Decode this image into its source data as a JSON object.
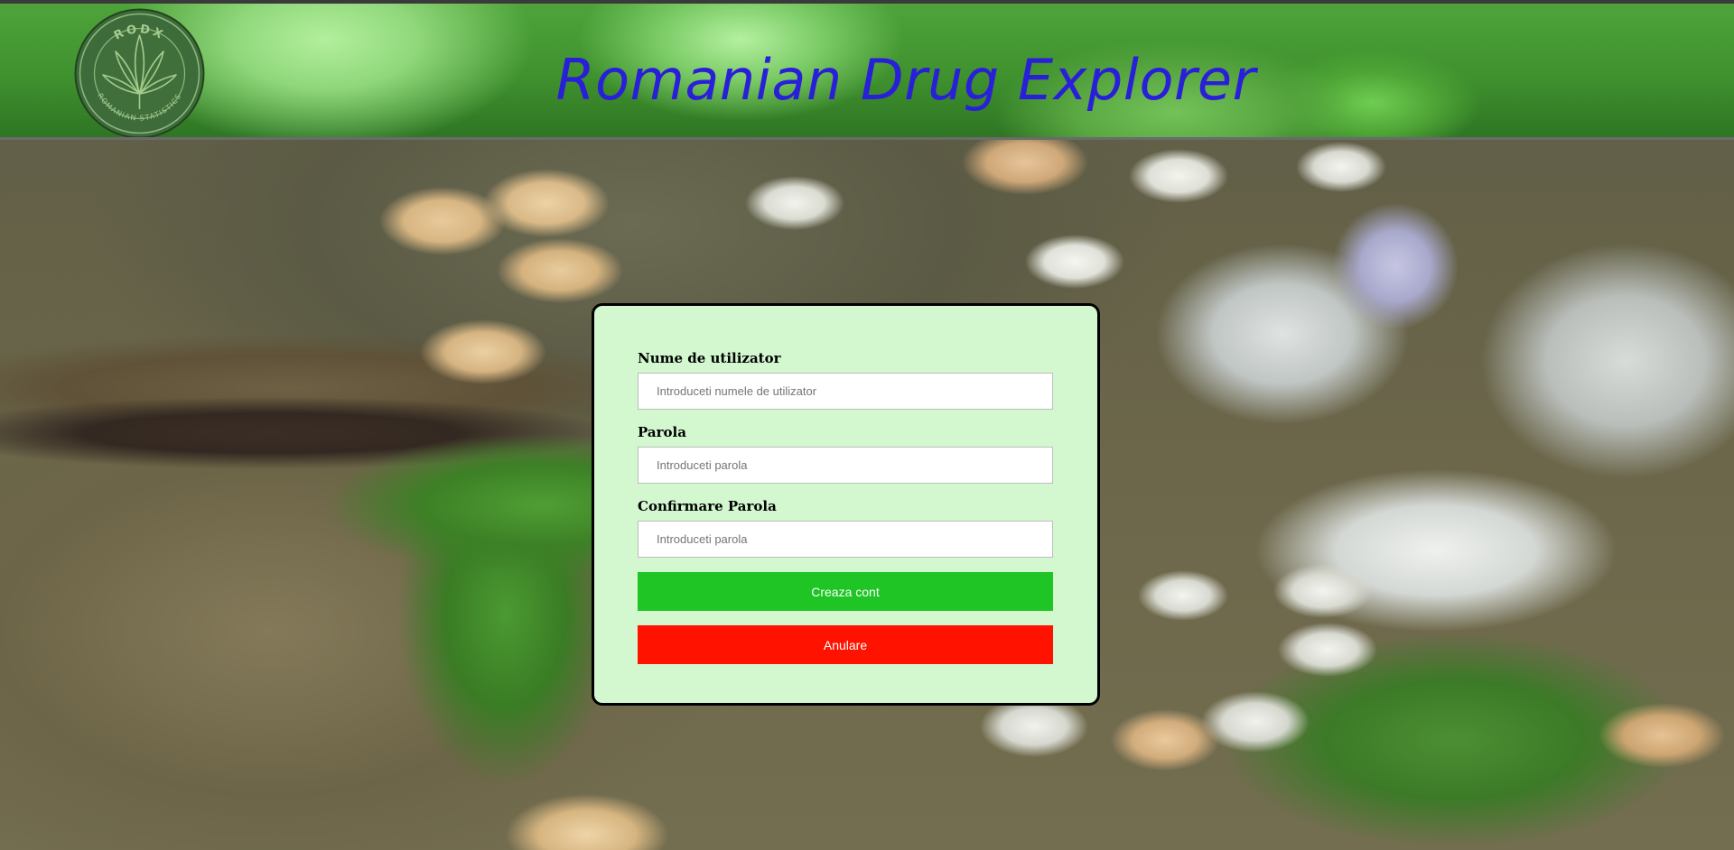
{
  "header": {
    "title": "Romanian Drug Explorer",
    "logo": {
      "top_text": "RODX",
      "bottom_text": "ROMANIAN STATISTICS",
      "icon": "cannabis-leaf-icon"
    }
  },
  "form": {
    "username": {
      "label": "Nume de utilizator",
      "placeholder": "Introduceti numele de utilizator",
      "value": ""
    },
    "password": {
      "label": "Parola",
      "placeholder": "Introduceti parola",
      "value": ""
    },
    "confirm_password": {
      "label": "Confirmare Parola",
      "placeholder": "Introduceti parola",
      "value": ""
    },
    "create_button": "Creaza cont",
    "cancel_button": "Anulare"
  },
  "colors": {
    "title": "#2a1fd8",
    "card_background": "#d3f8d0",
    "create_button": "#1ec524",
    "cancel_button": "#ff1200"
  }
}
